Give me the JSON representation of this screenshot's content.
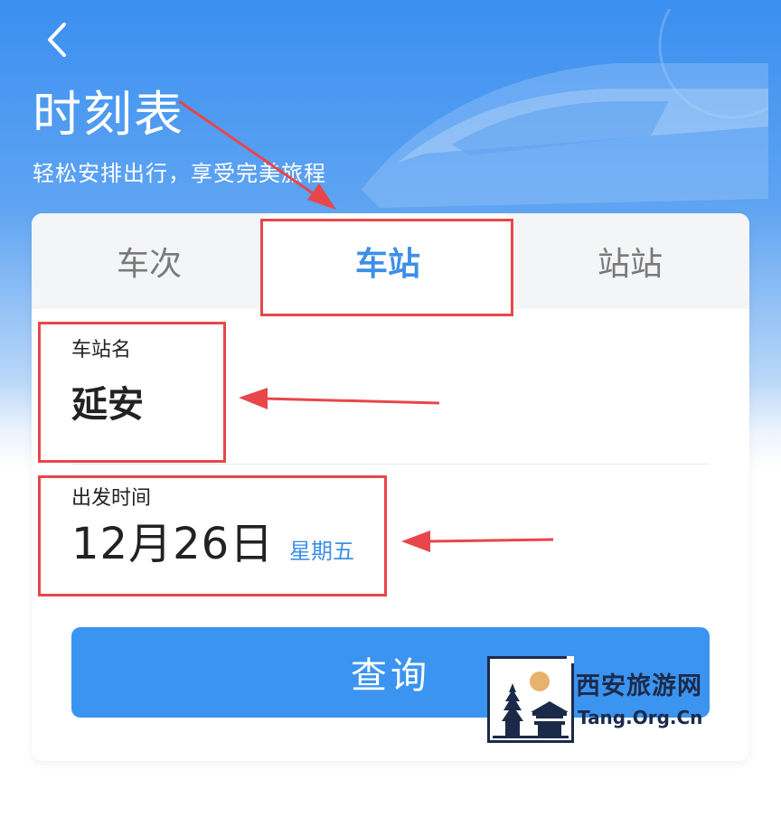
{
  "header": {
    "back_icon": "chevron-left-icon",
    "title": "时刻表",
    "subtitle": "轻松安排出行，享受完美旅程"
  },
  "tabs": [
    {
      "label": "车次",
      "active": false
    },
    {
      "label": "车站",
      "active": true
    },
    {
      "label": "站站",
      "active": false
    }
  ],
  "station_field": {
    "label": "车站名",
    "value": "延安"
  },
  "date_field": {
    "label": "出发时间",
    "value": "12月26日",
    "weekday": "星期五"
  },
  "query_button": {
    "label": "查询"
  },
  "watermark": {
    "name": "西安旅游网",
    "domain": "Tang.Org.Cn"
  },
  "colors": {
    "accent": "#3a94f0",
    "header_blue": "#3a8ff0",
    "annotation_red": "#e8464a"
  }
}
